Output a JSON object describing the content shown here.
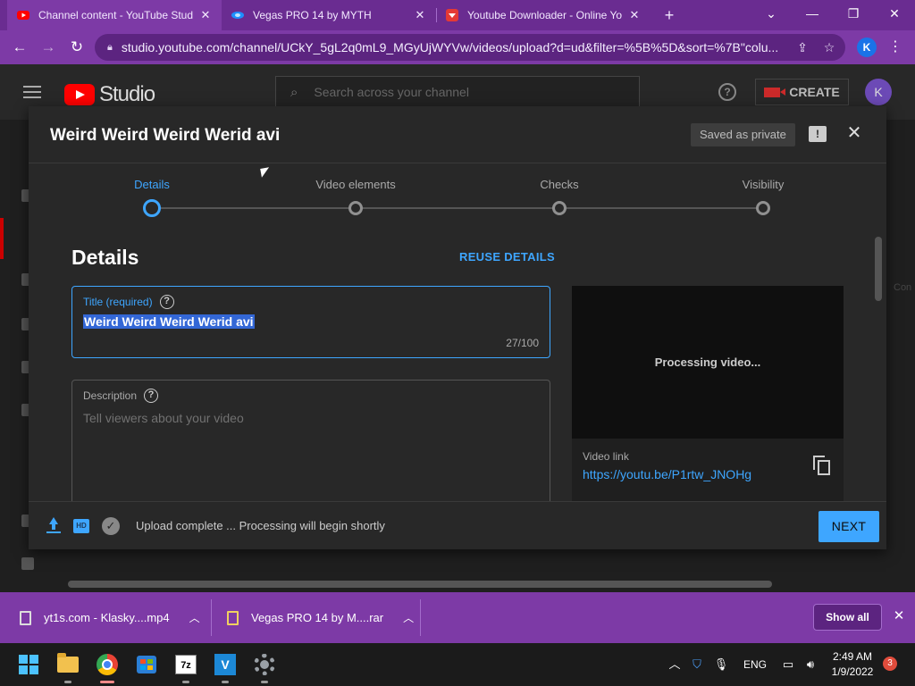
{
  "browser": {
    "tabs": [
      {
        "title": "Channel content - YouTube Studio",
        "favicon_color": "#ff0000",
        "active": true
      },
      {
        "title": "Vegas PRO 14 by MYTH",
        "favicon_color": "#1e90ff",
        "active": false
      },
      {
        "title": "Youtube Downloader - Online Youtube",
        "favicon_color": "#e53935",
        "active": false
      }
    ],
    "new_tab_symbol": "+",
    "url": "studio.youtube.com/channel/UCkY_5gL2q0mL9_MGyUjWYVw/videos/upload?d=ud&filter=%5B%5D&sort=%7B\"colu...",
    "profile_initial": "K",
    "window_controls": [
      "⌄",
      "—",
      "❐",
      "✕"
    ]
  },
  "studio": {
    "brand": "Studio",
    "search_placeholder": "Search across your channel",
    "create_label": "CREATE",
    "avatar_initial": "K",
    "help_symbol": "?"
  },
  "dialog": {
    "title": "Weird Weird Weird Werid avi",
    "saved_status": "Saved as private",
    "steps": [
      {
        "label": "Details",
        "active": true
      },
      {
        "label": "Video elements",
        "active": false
      },
      {
        "label": "Checks",
        "active": false
      },
      {
        "label": "Visibility",
        "active": false
      }
    ],
    "section_title": "Details",
    "reuse_details": "REUSE DETAILS",
    "title_field": {
      "label": "Title (required)",
      "value": "Weird Weird Weird Werid avi",
      "char_count": "27/100"
    },
    "description_field": {
      "label": "Description",
      "placeholder": "Tell viewers about your video"
    },
    "preview": {
      "processing_text": "Processing video...",
      "video_link_label": "Video link",
      "video_link_url": "https://youtu.be/P1rtw_JNOHg"
    },
    "footer": {
      "status": "Upload complete ... Processing will begin shortly",
      "next_label": "NEXT",
      "hd_badge": "HD"
    }
  },
  "download_shelf": {
    "items": [
      {
        "name": "yt1s.com - Klasky....mp4"
      },
      {
        "name": "Vegas PRO 14 by M....rar"
      }
    ],
    "show_all": "Show all"
  },
  "taskbar": {
    "apps": [
      "start",
      "file-explorer",
      "chrome",
      "microsoft-store",
      "7zip",
      "vegas-pro",
      "settings"
    ],
    "sevenzip_label": "7z",
    "vegas_label": "V",
    "language": "ENG",
    "time": "2:49 AM",
    "date": "1/9/2022",
    "notification_count": "3"
  },
  "colors": {
    "accent": "#3ea6ff",
    "chrome_theme": "#7d3aa6",
    "studio_bg": "#282828",
    "title_highlight": "#3367d6"
  }
}
